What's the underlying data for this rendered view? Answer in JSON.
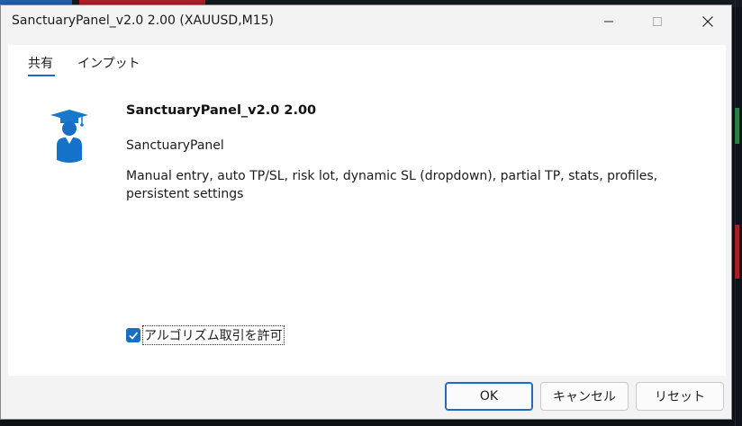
{
  "window": {
    "title": "SanctuaryPanel_v2.0 2.00 (XAUUSD,M15)"
  },
  "tabs": [
    {
      "label": "共有",
      "active": true
    },
    {
      "label": "インプット",
      "active": false
    }
  ],
  "program": {
    "name": "SanctuaryPanel_v2.0 2.00",
    "author": "SanctuaryPanel",
    "description": "Manual entry, auto TP/SL, risk lot, dynamic SL (dropdown), partial TP, stats, profiles, persistent settings",
    "icon": "graduate-icon"
  },
  "options": {
    "allow_algo_label": "アルゴリズム取引を許可",
    "allow_algo_checked": true
  },
  "buttons": {
    "ok": "OK",
    "cancel": "キャンセル",
    "reset": "リセット"
  },
  "colors": {
    "accent": "#1a6dc4",
    "icon": "#1679c9"
  }
}
